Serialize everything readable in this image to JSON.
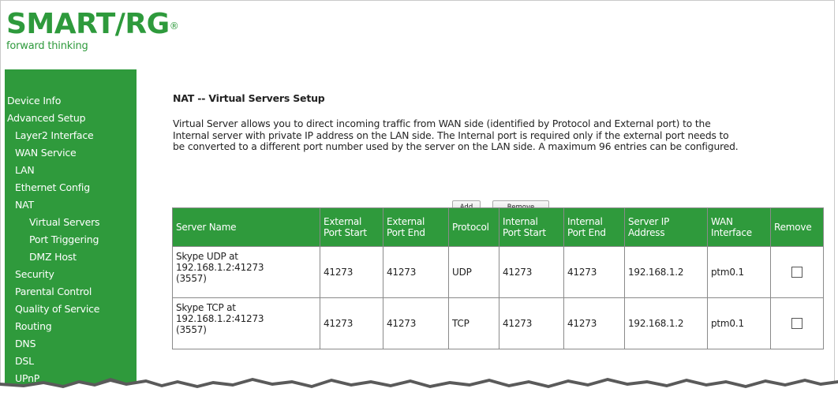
{
  "logo": {
    "brand": "SMART/RG",
    "tagline": "forward thinking"
  },
  "sidebar": {
    "items": [
      {
        "label": "Device Info",
        "level": 0
      },
      {
        "label": "Advanced Setup",
        "level": 0
      },
      {
        "label": "Layer2 Interface",
        "level": 1
      },
      {
        "label": "WAN Service",
        "level": 1
      },
      {
        "label": "LAN",
        "level": 1
      },
      {
        "label": "Ethernet Config",
        "level": 1
      },
      {
        "label": "NAT",
        "level": 1
      },
      {
        "label": "Virtual Servers",
        "level": 2
      },
      {
        "label": "Port Triggering",
        "level": 2
      },
      {
        "label": "DMZ Host",
        "level": 2
      },
      {
        "label": "Security",
        "level": 1
      },
      {
        "label": "Parental Control",
        "level": 1
      },
      {
        "label": "Quality of Service",
        "level": 1
      },
      {
        "label": "Routing",
        "level": 1
      },
      {
        "label": "DNS",
        "level": 1
      },
      {
        "label": "DSL",
        "level": 1
      },
      {
        "label": "UPnP",
        "level": 1
      }
    ]
  },
  "main": {
    "title": "NAT -- Virtual Servers Setup",
    "description_lines": [
      "Virtual Server allows you to direct incoming traffic from WAN side (identified by Protocol and External port) to the",
      "Internal server with private IP address on the LAN side. The Internal port is required only if the external port needs to",
      "be converted to a different port number used by the server on the LAN side. A maximum 96 entries can be configured."
    ],
    "add_label": "Add",
    "remove_label": "Remove"
  },
  "table": {
    "headers": [
      [
        "Server Name"
      ],
      [
        "External",
        "Port Start"
      ],
      [
        "External",
        "Port End"
      ],
      [
        "Protocol"
      ],
      [
        "Internal",
        "Port Start"
      ],
      [
        "Internal",
        "Port End"
      ],
      [
        "Server IP",
        "Address"
      ],
      [
        "WAN",
        "Interface"
      ],
      [
        "Remove"
      ]
    ],
    "rows": [
      {
        "server_name": [
          "Skype UDP at",
          "192.168.1.2:41273",
          "(3557)"
        ],
        "ext_start": "41273",
        "ext_end": "41273",
        "protocol": "UDP",
        "int_start": "41273",
        "int_end": "41273",
        "server_ip": "192.168.1.2",
        "wan_if": "ptm0.1",
        "remove_checked": false
      },
      {
        "server_name": [
          "Skype TCP at",
          "192.168.1.2:41273",
          "(3557)"
        ],
        "ext_start": "41273",
        "ext_end": "41273",
        "protocol": "TCP",
        "int_start": "41273",
        "int_end": "41273",
        "server_ip": "192.168.1.2",
        "wan_if": "ptm0.1",
        "remove_checked": false
      }
    ]
  },
  "colors": {
    "brand_green": "#2f9a3c",
    "header_text": "#ffffff",
    "border": "#8a8a8a"
  }
}
